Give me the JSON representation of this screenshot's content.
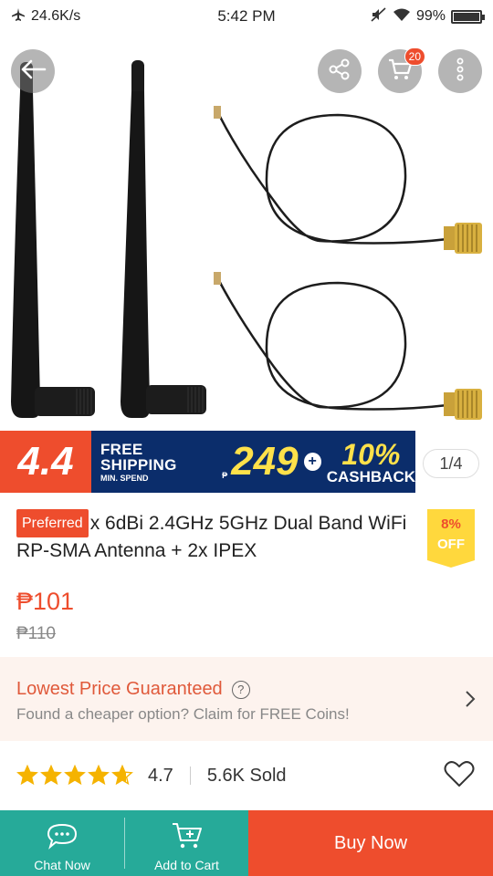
{
  "status_bar": {
    "net_speed": "24.6K/s",
    "time": "5:42 PM",
    "battery": "99%",
    "battery_level": 0.99
  },
  "top_actions": {
    "cart_count": "20",
    "icons": [
      "back-arrow-icon",
      "share-icon",
      "cart-icon",
      "more-icon"
    ]
  },
  "promo_banner": {
    "event": "4.4",
    "free_shipping": "FREE SHIPPING",
    "min_spend_label": "MIN. SPEND",
    "currency": "₱",
    "min_spend": "249",
    "plus": "+",
    "cashback_percent": "10%",
    "cashback_label": "CASHBACK"
  },
  "image_counter": "1/4",
  "product": {
    "badge": "Preferred",
    "title": "x 6dBi 2.4GHz 5GHz Dual Band WiFi RP-SMA Antenna + 2x IPEX",
    "discount_percent": "8%",
    "discount_label": "OFF",
    "price": "₱101",
    "original_price": "₱110"
  },
  "guarantee": {
    "title": "Lowest Price Guaranteed",
    "subtitle": "Found a cheaper option? Claim for FREE Coins!"
  },
  "rating": {
    "stars": 4.7,
    "score": "4.7",
    "sold": "5.6K Sold"
  },
  "bottom_bar": {
    "chat": "Chat Now",
    "add_to_cart": "Add to Cart",
    "buy_now": "Buy Now"
  },
  "colors": {
    "brand": "#ee4d2d",
    "teal": "#26aa99",
    "banner_blue": "#0b2d6b",
    "star": "#f5b301"
  }
}
